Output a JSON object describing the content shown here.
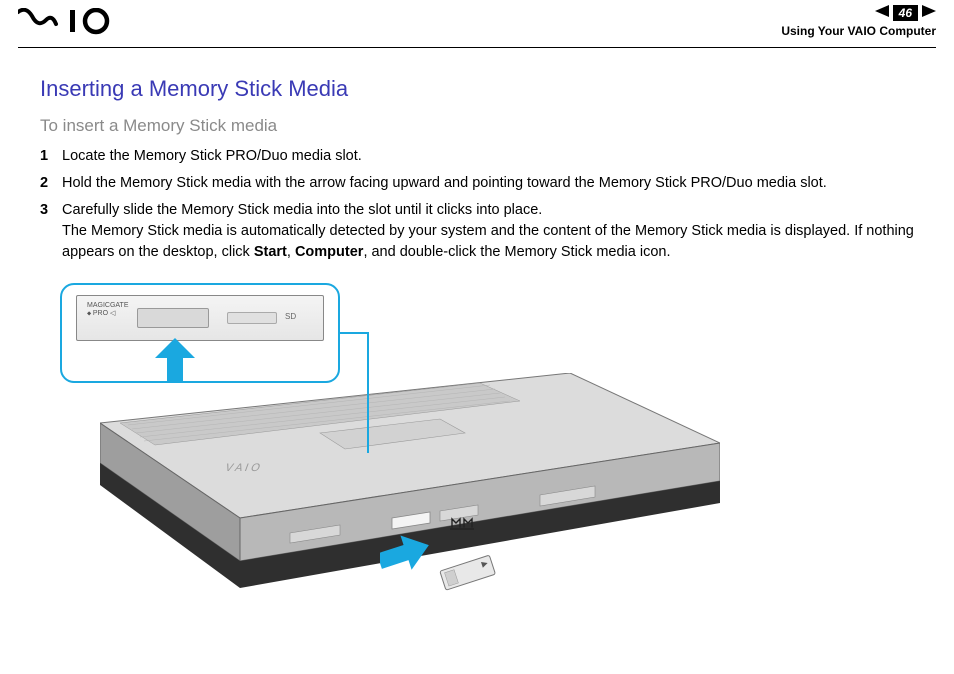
{
  "header": {
    "page_number": "46",
    "section": "Using Your VAIO Computer"
  },
  "title": "Inserting a Memory Stick Media",
  "subtitle": "To insert a Memory Stick media",
  "steps": [
    {
      "text": "Locate the Memory Stick PRO/Duo media slot."
    },
    {
      "text": "Hold the Memory Stick media with the arrow facing upward and pointing toward the Memory Stick PRO/Duo media slot."
    },
    {
      "line1": "Carefully slide the Memory Stick media into the slot until it clicks into place.",
      "line2_pre": "The Memory Stick media is automatically detected by your system and the content of the Memory Stick media is displayed. If nothing appears on the desktop, click ",
      "bold1": "Start",
      "sep1": ", ",
      "bold2": "Computer",
      "line2_post": ", and double-click the Memory Stick media icon."
    }
  ],
  "callout": {
    "label_top": "MAGICGATE",
    "label_bottom": "PRO",
    "sd_label": "SD"
  },
  "icons": {
    "prev": "prev-arrow-icon",
    "next": "next-arrow-icon",
    "up": "up-arrow-icon",
    "insert": "insert-arrow-icon",
    "memorystick_logo": "memorystick-logo-icon"
  },
  "colors": {
    "accent": "#1aa8e0",
    "title": "#3a3ab5"
  }
}
